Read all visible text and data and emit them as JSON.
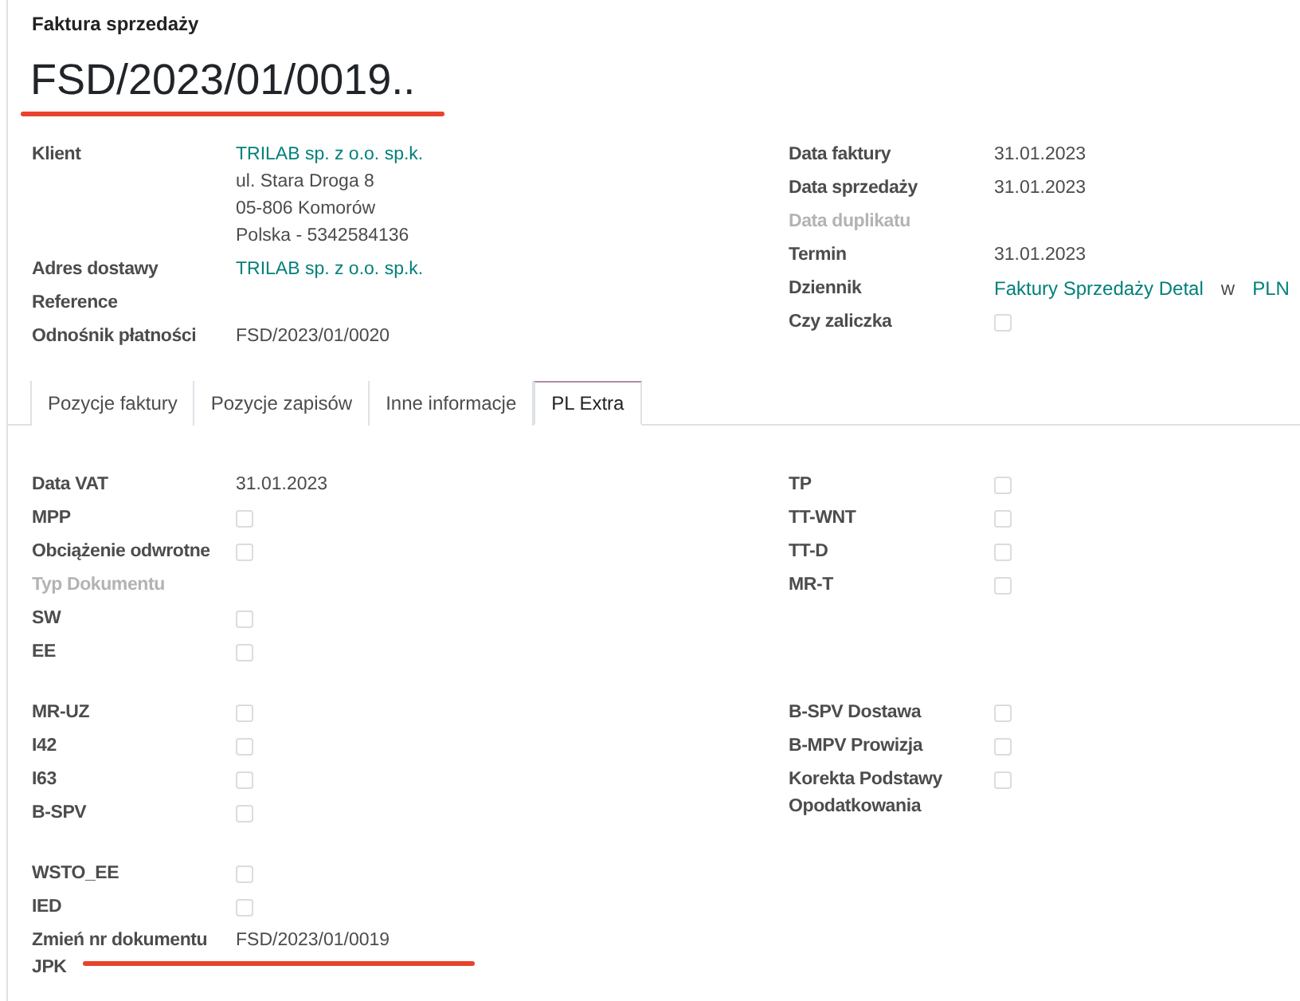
{
  "form_type": "Faktura sprzedaży",
  "title": "FSD/2023/01/0019..",
  "header": {
    "left": [
      {
        "label": "Klient",
        "kind": "link",
        "value": "TRILAB sp. z o.o. sp.k.",
        "extra_lines": [
          "ul. Stara Droga 8",
          "05-806 Komorów",
          "Polska - 5342584136"
        ]
      },
      {
        "label": "Adres dostawy",
        "kind": "link",
        "value": "TRILAB sp. z o.o. sp.k."
      },
      {
        "label": "Reference",
        "kind": "empty"
      },
      {
        "label": "Odnośnik płatności",
        "kind": "text",
        "value": "FSD/2023/01/0020"
      }
    ],
    "right": [
      {
        "label": "Data faktury",
        "kind": "text",
        "value": "31.01.2023"
      },
      {
        "label": "Data sprzedaży",
        "kind": "text",
        "value": "31.01.2023"
      },
      {
        "label": "Data duplikatu",
        "kind": "empty",
        "disabled": true
      },
      {
        "label": "Termin",
        "kind": "text",
        "value": "31.01.2023"
      },
      {
        "label": "Dziennik",
        "kind": "journal",
        "value": "Faktury Sprzedaży Detal",
        "connector": "w",
        "currency": "PLN"
      },
      {
        "label": "Czy zaliczka",
        "kind": "checkbox",
        "checked": false
      }
    ]
  },
  "tabs": [
    {
      "label": "Pozycje faktury",
      "selected": false
    },
    {
      "label": "Pozycje zapisów",
      "selected": false
    },
    {
      "label": "Inne informacje",
      "selected": false
    },
    {
      "label": "PL Extra",
      "selected": true
    }
  ],
  "sections": [
    {
      "left": [
        {
          "label": "Data VAT",
          "kind": "text",
          "value": "31.01.2023"
        },
        {
          "label": "MPP",
          "kind": "checkbox",
          "checked": false
        },
        {
          "label": "Obciążenie odwrotne",
          "kind": "checkbox",
          "checked": false
        },
        {
          "label": "Typ Dokumentu",
          "kind": "empty",
          "disabled": true
        },
        {
          "label": "SW",
          "kind": "checkbox",
          "checked": false
        },
        {
          "label": "EE",
          "kind": "checkbox",
          "checked": false
        }
      ],
      "right": [
        {
          "label": "TP",
          "kind": "checkbox",
          "checked": false
        },
        {
          "label": "TT-WNT",
          "kind": "checkbox",
          "checked": false
        },
        {
          "label": "TT-D",
          "kind": "checkbox",
          "checked": false
        },
        {
          "label": "MR-T",
          "kind": "checkbox",
          "checked": false
        }
      ]
    },
    {
      "left": [
        {
          "label": "MR-UZ",
          "kind": "checkbox",
          "checked": false
        },
        {
          "label": "I42",
          "kind": "checkbox",
          "checked": false
        },
        {
          "label": "I63",
          "kind": "checkbox",
          "checked": false
        },
        {
          "label": "B-SPV",
          "kind": "checkbox",
          "checked": false
        }
      ],
      "right": [
        {
          "label": "B-SPV Dostawa",
          "kind": "checkbox",
          "checked": false
        },
        {
          "label": "B-MPV Prowizja",
          "kind": "checkbox",
          "checked": false
        },
        {
          "label": "Korekta Podstawy Opodatkowania",
          "kind": "checkbox",
          "checked": false
        }
      ]
    },
    {
      "left": [
        {
          "label": "WSTO_EE",
          "kind": "checkbox",
          "checked": false
        },
        {
          "label": "IED",
          "kind": "checkbox",
          "checked": false
        },
        {
          "label": "Zmień nr dokumentu JPK",
          "kind": "text",
          "value": "FSD/2023/01/0019"
        }
      ]
    }
  ]
}
